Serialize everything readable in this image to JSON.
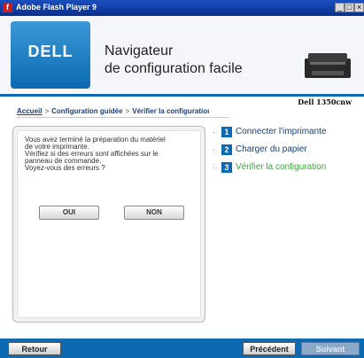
{
  "window": {
    "title": "Adobe Flash Player 9",
    "controls": [
      "_",
      "□",
      "×"
    ]
  },
  "header": {
    "logo_text": "DELL",
    "title_line1": "Navigateur",
    "title_line2": "de configuration facile",
    "model": "Dell 1350cnw"
  },
  "breadcrumb": {
    "items": [
      "Accueil",
      "Configuration guidée",
      "Vérifier la configuratioı"
    ],
    "separator": ">"
  },
  "panel": {
    "text_lines": [
      "Vous avez terminé la préparation du matériel",
      "de votre imprimante.",
      "Vérifiez si des erreurs sont affichées sur le",
      "panneau de commande.",
      "Voyez-vous des erreurs ?"
    ],
    "yes_label": "OUI",
    "no_label": "NON"
  },
  "steps": [
    {
      "number": "1",
      "label": "Connecter l'imprimante",
      "state": "done"
    },
    {
      "number": "2",
      "label": "Charger du papier",
      "state": "done"
    },
    {
      "number": "3",
      "label": "Vérifier la configuration",
      "state": "active"
    }
  ],
  "footer": {
    "back_label": "Retour",
    "prev_label": "Précédent",
    "next_label": "Suivant"
  },
  "colors": {
    "accent": "#0b6ab1",
    "active_step": "#3ea93e",
    "link": "#1b3f7a"
  }
}
